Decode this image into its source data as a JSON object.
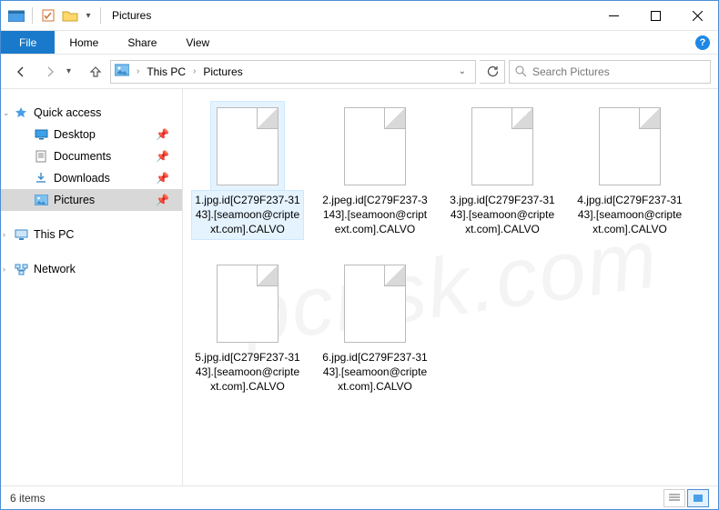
{
  "title": "Pictures",
  "menubar": {
    "file": "File",
    "items": [
      "Home",
      "Share",
      "View"
    ]
  },
  "breadcrumb": {
    "parts": [
      "This PC",
      "Pictures"
    ]
  },
  "search": {
    "placeholder": "Search Pictures"
  },
  "sidebar": {
    "quick_access": "Quick access",
    "quick_items": [
      {
        "label": "Desktop",
        "icon": "desktop"
      },
      {
        "label": "Documents",
        "icon": "documents"
      },
      {
        "label": "Downloads",
        "icon": "downloads"
      },
      {
        "label": "Pictures",
        "icon": "pictures",
        "selected": true
      }
    ],
    "this_pc": "This PC",
    "network": "Network"
  },
  "files": [
    {
      "name": "1.jpg.id[C279F237-3143].[seamoon@criptext.com].CALVO",
      "selected": true
    },
    {
      "name": "2.jpeg.id[C279F237-3143].[seamoon@criptext.com].CALVO"
    },
    {
      "name": "3.jpg.id[C279F237-3143].[seamoon@criptext.com].CALVO"
    },
    {
      "name": "4.jpg.id[C279F237-3143].[seamoon@criptext.com].CALVO"
    },
    {
      "name": "5.jpg.id[C279F237-3143].[seamoon@criptext.com].CALVO"
    },
    {
      "name": "6.jpg.id[C279F237-3143].[seamoon@criptext.com].CALVO"
    }
  ],
  "status": {
    "count": "6 items"
  },
  "watermark": "pcrisk.com"
}
